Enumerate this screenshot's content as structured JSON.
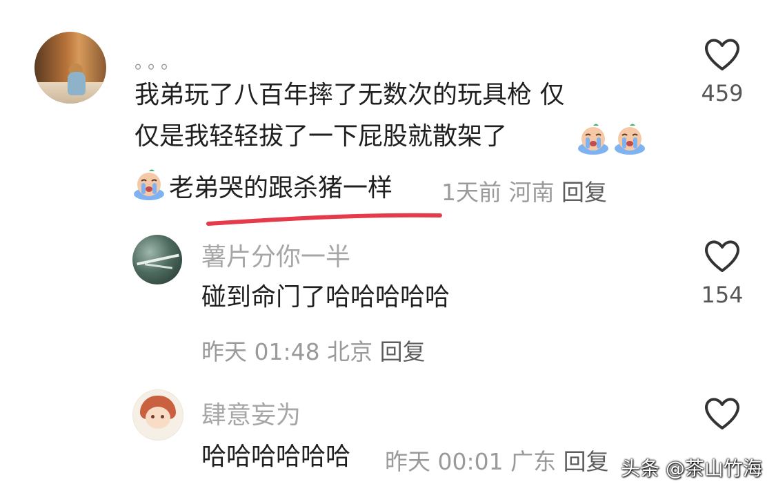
{
  "main_comment": {
    "username": "。。。",
    "text_line_1": "我弟玩了八百年摔了无数次的玩具枪 仅",
    "text_line_2": "仅是我轻轻拔了一下屁股就散架了",
    "text_line_3": "老弟哭的跟杀猪一样",
    "time": "1天前",
    "location": "河南",
    "reply_label": "回复",
    "like_count": "459",
    "emojis": [
      "crying-emoji",
      "crying-emoji",
      "crying-emoji"
    ]
  },
  "replies": [
    {
      "username": "薯片分你一半",
      "text": "碰到命门了哈哈哈哈哈",
      "time": "昨天 01:48",
      "location": "北京",
      "reply_label": "回复",
      "like_count": "154"
    },
    {
      "username": "肆意妄为",
      "text": "哈哈哈哈哈哈",
      "time": "昨天 00:01",
      "location": "广东",
      "reply_label": "回复",
      "like_count": ""
    }
  ],
  "watermark": {
    "text": "头条 @茶山竹海"
  },
  "colors": {
    "underline": "#e53a4a",
    "meta_gray": "#9a9a9a",
    "username_gray": "#a6a6a6"
  }
}
